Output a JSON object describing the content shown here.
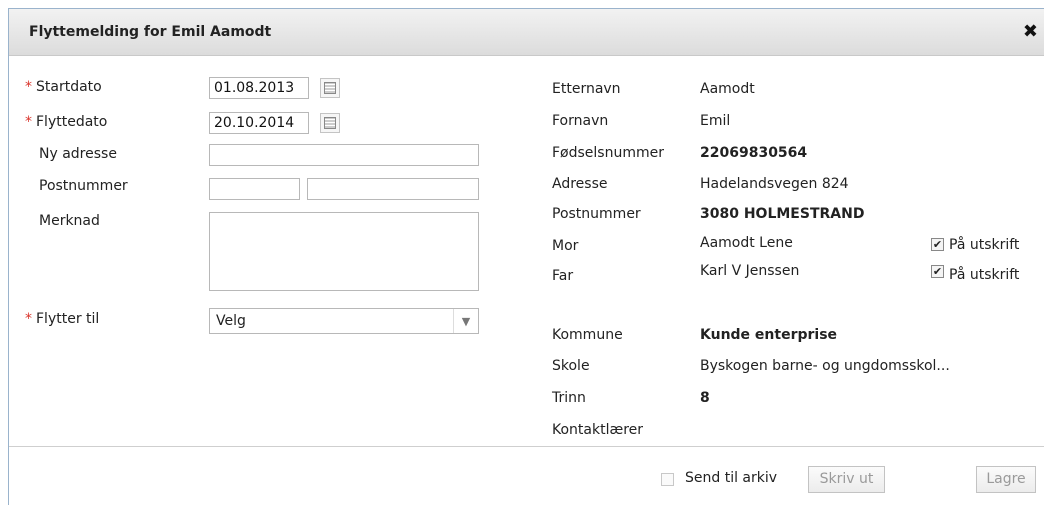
{
  "dialog": {
    "title": "Flyttemelding for Emil Aamodt",
    "close_icon": "close-icon"
  },
  "form": {
    "required_marker": "*",
    "startdato": {
      "label": "Startdato",
      "value": "01.08.2013"
    },
    "flyttedato": {
      "label": "Flyttedato",
      "value": "20.10.2014"
    },
    "ny_adresse": {
      "label": "Ny adresse",
      "value": ""
    },
    "postnummer": {
      "label": "Postnummer",
      "value_nr": "",
      "value_sted": ""
    },
    "merknad": {
      "label": "Merknad",
      "value": ""
    },
    "flytter_til": {
      "label": "Flytter til",
      "selected": "Velg"
    }
  },
  "info": {
    "etternavn": {
      "label": "Etternavn",
      "value": "Aamodt"
    },
    "fornavn": {
      "label": "Fornavn",
      "value": "Emil"
    },
    "fodselsnummer": {
      "label": "Fødselsnummer",
      "value": "22069830564"
    },
    "adresse": {
      "label": "Adresse",
      "value": "Hadelandsvegen 824"
    },
    "postnummer": {
      "label": "Postnummer",
      "value": "3080 HOLMESTRAND"
    },
    "mor": {
      "label": "Mor",
      "value": "Aamodt Lene",
      "print_label": "På utskrift",
      "print_checked": true
    },
    "far": {
      "label": "Far",
      "value": "Karl V Jenssen",
      "print_label": "På utskrift",
      "print_checked": true
    },
    "kommune": {
      "label": "Kommune",
      "value": "Kunde enterprise"
    },
    "skole": {
      "label": "Skole",
      "value": "Byskogen barne- og ungdomsskol..."
    },
    "trinn": {
      "label": "Trinn",
      "value": "8"
    },
    "kontaktlaerer": {
      "label": "Kontaktlærer",
      "value": ""
    }
  },
  "footer": {
    "send_til_arkiv": {
      "label": "Send til arkiv",
      "checked": false
    },
    "skriv_ut": "Skriv ut",
    "lagre": "Lagre"
  }
}
